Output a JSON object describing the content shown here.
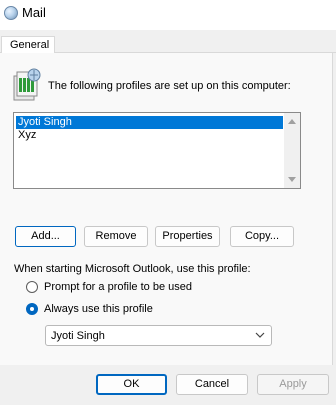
{
  "window": {
    "title": "Mail",
    "icon": "mail-setup-icon"
  },
  "tabs": [
    {
      "label": "General",
      "selected": true
    }
  ],
  "intro": {
    "text": "The following profiles are set up on this computer:",
    "icon": "profiles-icon"
  },
  "profiles": {
    "items": [
      {
        "label": "Jyoti Singh",
        "selected": true
      },
      {
        "label": "Xyz",
        "selected": false
      }
    ]
  },
  "profile_buttons": {
    "add": "Add...",
    "remove": "Remove",
    "properties": "Properties",
    "copy": "Copy..."
  },
  "startup": {
    "label": "When starting Microsoft Outlook, use this profile:",
    "prompt_option": "Prompt for a profile to be used",
    "always_option": "Always use this profile",
    "selected_option": "always",
    "selected_profile": "Jyoti Singh"
  },
  "footer": {
    "ok": "OK",
    "cancel": "Cancel",
    "apply": "Apply",
    "apply_enabled": false
  },
  "colors": {
    "selection": "#0078d7",
    "accent": "#0067c0"
  }
}
